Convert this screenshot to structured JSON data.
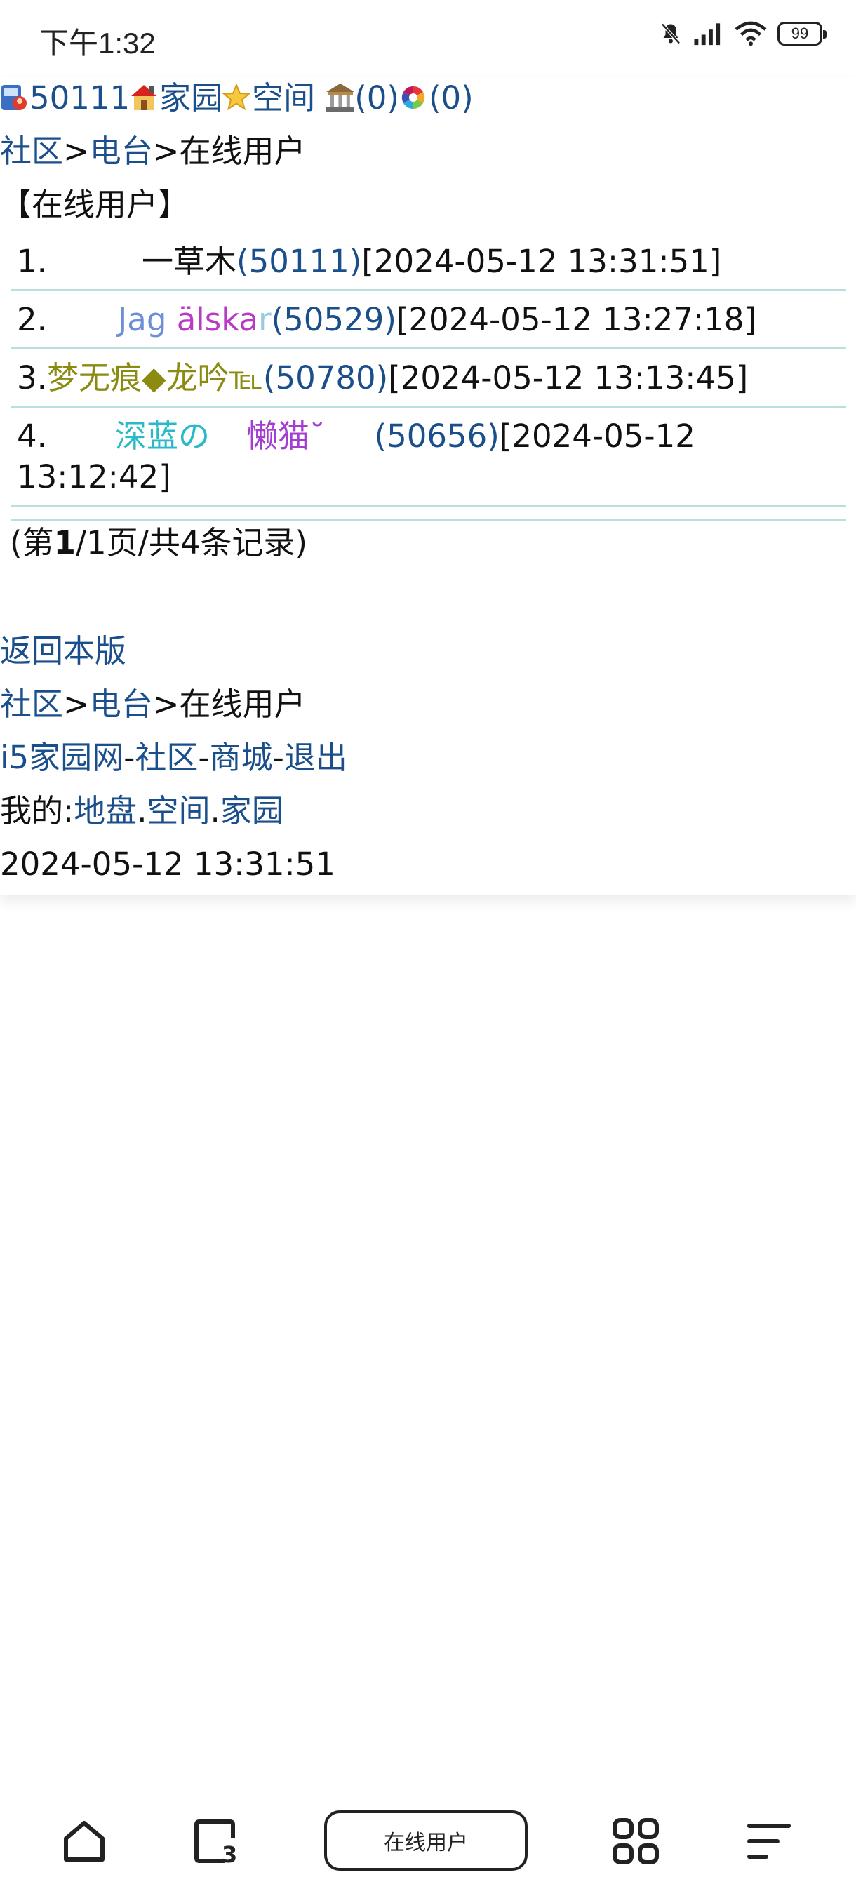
{
  "status": {
    "time": "下午1:32",
    "battery": "99",
    "icons": [
      "mute-bell-icon",
      "signal-icon",
      "wifi-icon",
      "battery-icon"
    ]
  },
  "header": {
    "uid": "50111",
    "home": "家园",
    "space": "空间",
    "count1": "(0)",
    "count2": "(0)"
  },
  "breadcrumb_top": {
    "community": "社区",
    "sep1": ">",
    "radio": "电台",
    "sep2": ">",
    "current": "在线用户"
  },
  "section_title": "【在线用户】",
  "users": [
    {
      "num": "1.",
      "name": "一草木",
      "uid": "(50111)",
      "time": "[2024-05-12 13:31:51]"
    },
    {
      "num": "2.",
      "name_a": "Jag ",
      "name_b": "älska",
      "name_c": "r",
      "uid": "(50529)",
      "time": "[2024-05-12 13:27:18]"
    },
    {
      "num": "3.",
      "name": "梦无痕◆龙吟℡",
      "uid": "(50780)",
      "time": "[2024-05-12 13:13:45]"
    },
    {
      "num": "4.",
      "name_a": "深蓝の",
      "name_b": "懒猫˘",
      "uid": "(50656)",
      "time_a": "[2024-05-12",
      "time_b": "13:12:42]"
    }
  ],
  "pagination": {
    "prefix": "(第",
    "page": "1",
    "rest": "/1页/共4条记录)"
  },
  "links": {
    "back": "返回本版",
    "site": "i5家园网",
    "dash1": "-",
    "community": "社区",
    "dash2": "-",
    "mall": "商城",
    "dash3": "-",
    "logout": "退出",
    "mine_label": "我的:",
    "land": "地盘",
    "dot1": ".",
    "space": "空间",
    "dot2": ".",
    "home": "家园"
  },
  "footer_time": "2024-05-12 13:31:51",
  "bottom_nav": {
    "tab_count": "3",
    "url_label": "在线用户"
  },
  "colors": {
    "link": "#1a4f8c",
    "divider": "#b9e0dc"
  }
}
